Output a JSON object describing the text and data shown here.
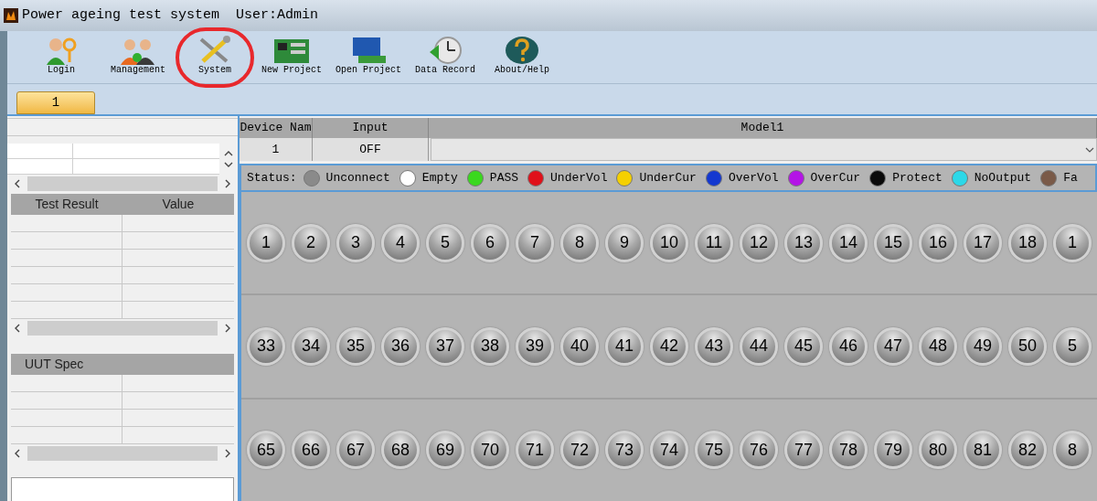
{
  "window": {
    "title": "Power ageing test system  User:Admin"
  },
  "toolbar": [
    {
      "label": "Login",
      "kind": "login",
      "highlighted": false
    },
    {
      "label": "Management",
      "kind": "users",
      "highlighted": false
    },
    {
      "label": "System",
      "kind": "tools",
      "highlighted": true
    },
    {
      "label": "New Project",
      "kind": "board",
      "highlighted": false
    },
    {
      "label": "Open Project",
      "kind": "monitor",
      "highlighted": false
    },
    {
      "label": "Data Record",
      "kind": "clock",
      "highlighted": false
    },
    {
      "label": "About/Help",
      "kind": "help",
      "highlighted": false
    }
  ],
  "tabs": [
    {
      "label": "1",
      "selected": true
    }
  ],
  "left_panel": {
    "test_result_table": {
      "columns": [
        "Test Result",
        "Value"
      ]
    },
    "uut_spec_table": {
      "columns": [
        "UUT Spec"
      ]
    }
  },
  "device_table": {
    "columns": [
      "Device Nam",
      "Input",
      "Model1"
    ],
    "row": [
      "1",
      "OFF"
    ]
  },
  "status_legend": {
    "label": "Status:",
    "items": [
      {
        "label": "Unconnect",
        "color": "#8a8a8a"
      },
      {
        "label": "Empty",
        "color": "#ffffff"
      },
      {
        "label": "PASS",
        "color": "#3ad81e"
      },
      {
        "label": "UnderVol",
        "color": "#e0101a"
      },
      {
        "label": "UnderCur",
        "color": "#f5d000"
      },
      {
        "label": "OverVol",
        "color": "#1438d0"
      },
      {
        "label": "OverCur",
        "color": "#b414e6"
      },
      {
        "label": "Protect",
        "color": "#0a0a0a"
      },
      {
        "label": "NoOutput",
        "color": "#2cd8e8"
      },
      {
        "label": "Fa",
        "color": "#7a5a48"
      }
    ]
  },
  "channel_rows": [
    [
      "1",
      "2",
      "3",
      "4",
      "5",
      "6",
      "7",
      "8",
      "9",
      "10",
      "11",
      "12",
      "13",
      "14",
      "15",
      "16",
      "17",
      "18",
      "1"
    ],
    [
      "33",
      "34",
      "35",
      "36",
      "37",
      "38",
      "39",
      "40",
      "41",
      "42",
      "43",
      "44",
      "45",
      "46",
      "47",
      "48",
      "49",
      "50",
      "5"
    ],
    [
      "65",
      "66",
      "67",
      "68",
      "69",
      "70",
      "71",
      "72",
      "73",
      "74",
      "75",
      "76",
      "77",
      "78",
      "79",
      "80",
      "81",
      "82",
      "8"
    ]
  ]
}
